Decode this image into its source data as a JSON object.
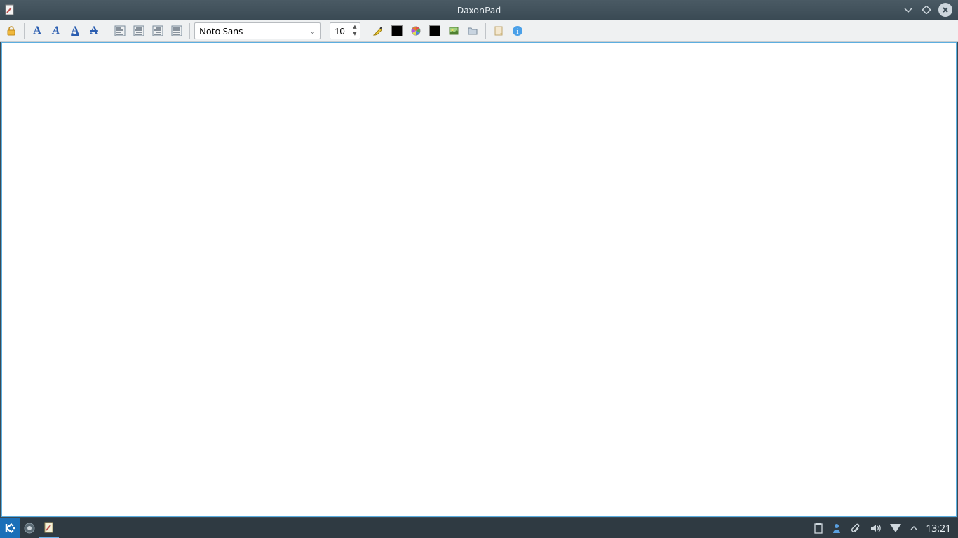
{
  "window": {
    "title": "DaxonPad"
  },
  "toolbar": {
    "font_family": "Noto Sans",
    "font_size": "10",
    "foreground_color": "#000000",
    "background_color": "#000000"
  },
  "editor": {
    "content": ""
  },
  "taskbar": {
    "clock": "13:21"
  }
}
